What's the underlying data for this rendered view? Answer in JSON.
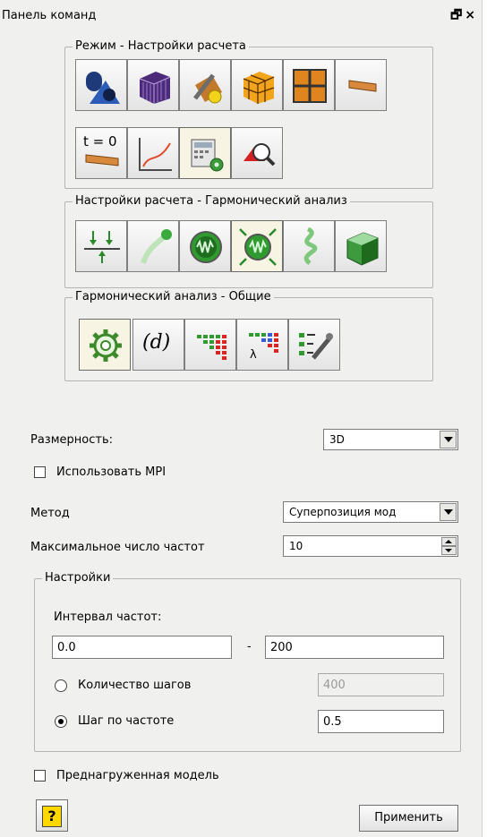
{
  "panel": {
    "title": "Панель команд",
    "float_glyph": "🗗",
    "close_glyph": "×"
  },
  "groups": {
    "mode": {
      "label": "Режим - Настройки расчета"
    },
    "analysis": {
      "label": "Настройки расчета - Гармонический анализ"
    },
    "general": {
      "label": "Гармонический анализ - Общие"
    }
  },
  "mode_buttons": [
    {
      "icon": "geometry-icon"
    },
    {
      "icon": "mesh-cube-icon"
    },
    {
      "icon": "material-wrench-icon"
    },
    {
      "icon": "grid-cube-icon"
    },
    {
      "icon": "grid-plane-icon"
    },
    {
      "icon": "beam-icon"
    },
    {
      "icon": "initial-time-icon",
      "text": "t = 0"
    },
    {
      "icon": "plot-curve-icon"
    },
    {
      "icon": "calculator-settings-icon"
    },
    {
      "icon": "zoom-model-icon"
    }
  ],
  "analysis_buttons": [
    {
      "icon": "loads-arrows-icon"
    },
    {
      "icon": "displacement-icon"
    },
    {
      "icon": "harmonic-icon"
    },
    {
      "icon": "harmonic-settings-icon"
    },
    {
      "icon": "spring-icon"
    },
    {
      "icon": "result-cube-icon"
    }
  ],
  "general_buttons": [
    {
      "icon": "gear-icon"
    },
    {
      "icon": "function-d-icon",
      "text": "(d)"
    },
    {
      "icon": "matrix-icon"
    },
    {
      "icon": "lambda-matrix-icon",
      "text": "λ"
    },
    {
      "icon": "list-tools-icon"
    }
  ],
  "form": {
    "dimension_label": "Размерность:",
    "dimension_value": "3D",
    "use_mpi_label": "Использовать MPI",
    "use_mpi_checked": false,
    "method_label": "Метод",
    "method_value": "Суперпозиция мод",
    "max_freq_label": "Максимальное число частот",
    "max_freq_value": "10",
    "settings_group_label": "Настройки",
    "interval_label": "Интервал частот:",
    "interval_from": "0.0",
    "interval_dash": "-",
    "interval_to": "200",
    "steps_label": "Количество шагов",
    "steps_value": "400",
    "freq_step_label": "Шаг по частоте",
    "freq_step_value": "0.5",
    "selected_mode": "freq_step",
    "preloaded_label": "Преднагруженная модель",
    "preloaded_checked": false,
    "help_glyph": "?",
    "apply_label": "Применить"
  },
  "colors": {
    "panel_bg": "#f0f0ee",
    "active_button": "#f7f4e3",
    "accent_green": "#2f9b2f"
  }
}
